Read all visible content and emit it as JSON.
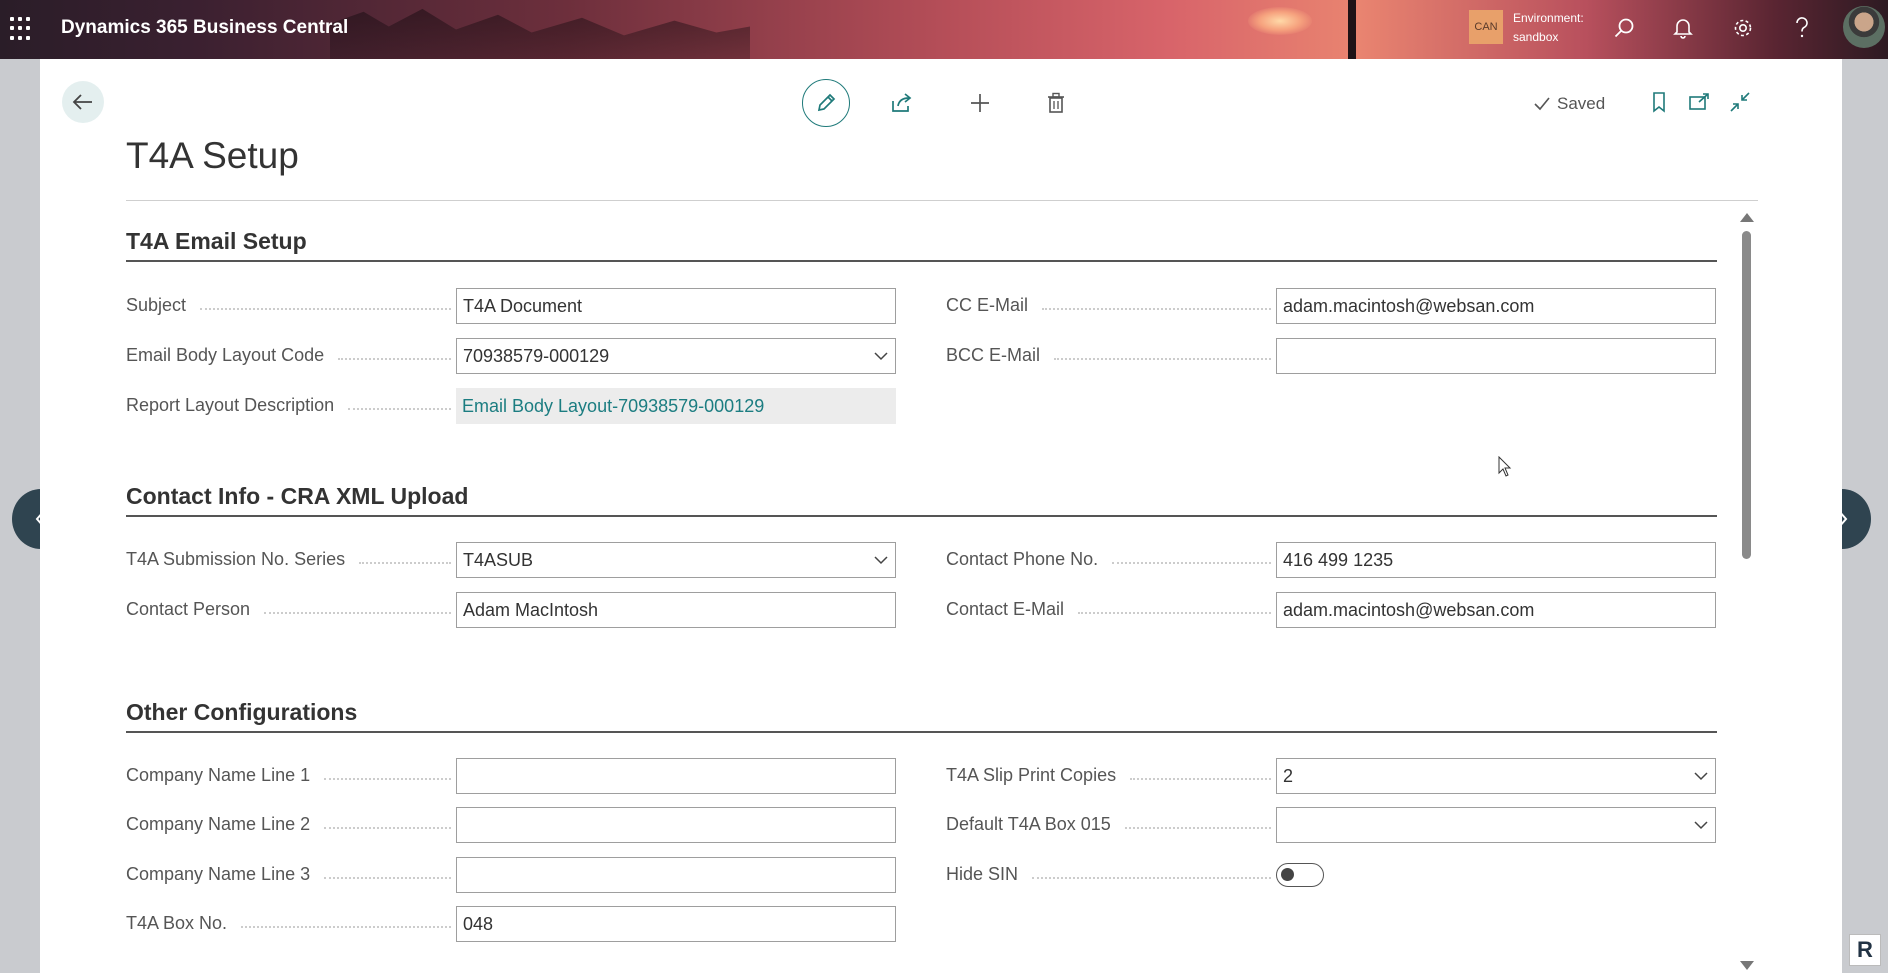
{
  "header": {
    "app_title": "Dynamics 365 Business Central",
    "environment_badge": "CAN",
    "environment_label": "Environment:",
    "environment_name": "sandbox"
  },
  "toolbar": {
    "saved_label": "Saved"
  },
  "page": {
    "title": "T4A Setup"
  },
  "sections": {
    "email": {
      "title": "T4A Email Setup",
      "fields": {
        "subject": {
          "label": "Subject",
          "value": "T4A Document"
        },
        "body_layout_code": {
          "label": "Email Body Layout Code",
          "value": "70938579-000129"
        },
        "report_layout_description": {
          "label": "Report Layout Description",
          "value": "Email Body Layout-70938579-000129"
        },
        "cc_email": {
          "label": "CC E-Mail",
          "value": "adam.macintosh@websan.com"
        },
        "bcc_email": {
          "label": "BCC E-Mail",
          "value": ""
        }
      }
    },
    "contact": {
      "title": "Contact Info - CRA XML Upload",
      "fields": {
        "submission_series": {
          "label": "T4A Submission No. Series",
          "value": "T4ASUB"
        },
        "contact_person": {
          "label": "Contact Person",
          "value": "Adam MacIntosh"
        },
        "contact_phone": {
          "label": "Contact Phone No.",
          "value": "416 499 1235"
        },
        "contact_email": {
          "label": "Contact E-Mail",
          "value": "adam.macintosh@websan.com"
        }
      }
    },
    "other": {
      "title": "Other Configurations",
      "fields": {
        "company_line_1": {
          "label": "Company Name Line 1",
          "value": ""
        },
        "company_line_2": {
          "label": "Company Name Line 2",
          "value": ""
        },
        "company_line_3": {
          "label": "Company Name Line 3",
          "value": ""
        },
        "box_no": {
          "label": "T4A Box No.",
          "value": "048"
        },
        "slip_print_copies": {
          "label": "T4A Slip Print Copies",
          "value": "2"
        },
        "default_box_015": {
          "label": "Default T4A Box 015",
          "value": ""
        },
        "hide_sin": {
          "label": "Hide SIN",
          "value": false
        }
      }
    }
  },
  "watermark": "R",
  "colors": {
    "accent": "#1f7a7a",
    "link": "#1c7d81",
    "nav_arrow_bg": "#2f4450",
    "env_badge_bg": "#e8a06a"
  },
  "icons": {
    "app_launcher": "waffle-icon",
    "search": "search-icon",
    "notifications": "bell-icon",
    "settings": "gear-icon",
    "help": "help-icon",
    "back": "arrow-left-icon",
    "edit": "pencil-icon",
    "share": "share-icon",
    "new": "plus-icon",
    "delete": "trash-icon",
    "bookmark": "bookmark-icon",
    "open_new": "open-new-window-icon",
    "collapse": "collapse-icon"
  }
}
